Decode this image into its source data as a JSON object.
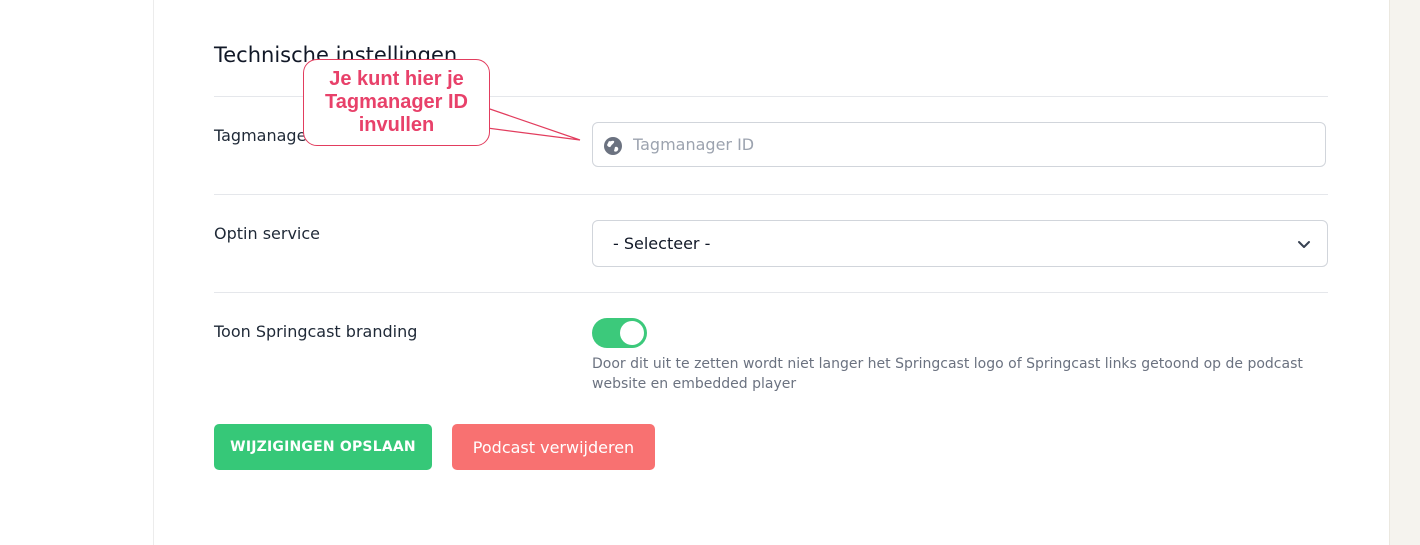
{
  "section": {
    "title": "Technische instellingen"
  },
  "tagmanager": {
    "label": "Tagmanager ID",
    "placeholder": "Tagmanager ID",
    "value": "",
    "icon": "globe-icon"
  },
  "optin": {
    "label": "Optin service",
    "selected": "- Selecteer -",
    "icon": "chevron-down-icon"
  },
  "branding": {
    "label": "Toon Springcast branding",
    "enabled": true,
    "help": "Door dit uit te zetten wordt niet langer het Springcast logo of Springcast links getoond op de podcast website en embedded player"
  },
  "buttons": {
    "save_label": "WIJZIGINGEN OPSLAAN",
    "delete_label": "Podcast verwijderen"
  },
  "annotation": {
    "text": "Je kunt hier je Tagmanager ID invullen"
  },
  "colors": {
    "accent_green": "#36c878",
    "danger_red": "#f87171",
    "annotation_red": "#e8416a"
  }
}
